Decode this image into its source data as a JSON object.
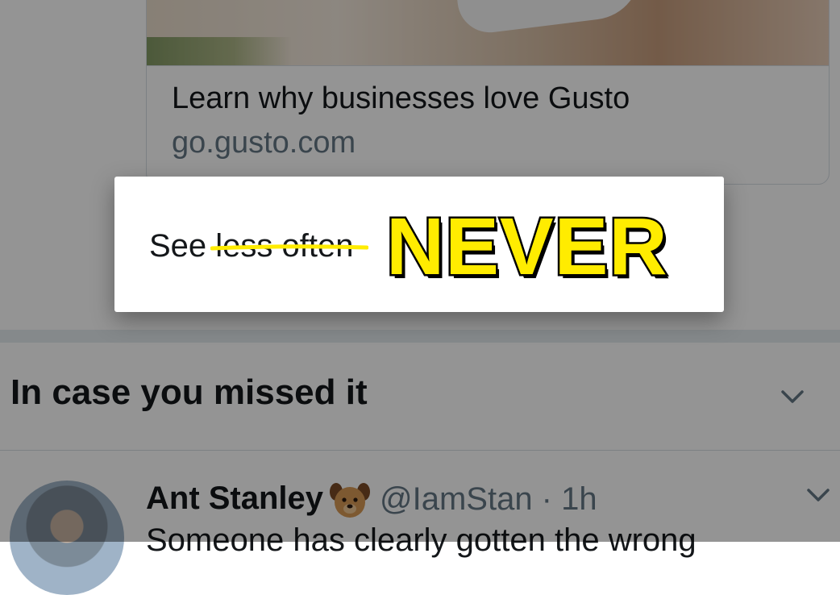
{
  "card": {
    "title": "Learn why businesses love Gusto",
    "domain": "go.gusto.com"
  },
  "section": {
    "title": "In case you missed it"
  },
  "tweet": {
    "author_name": "Ant Stanley",
    "author_emoji": "dog-face-icon",
    "handle_time": "@IamStan · 1h",
    "text": "Someone has clearly gotten the wrong"
  },
  "menu": {
    "see_label": "See",
    "struck_label": "less often",
    "annotation": "NEVER",
    "annotation_color": "#ffec00",
    "strike_color": "#ffec00"
  },
  "overlay_color": "rgba(0,0,0,0.42)"
}
